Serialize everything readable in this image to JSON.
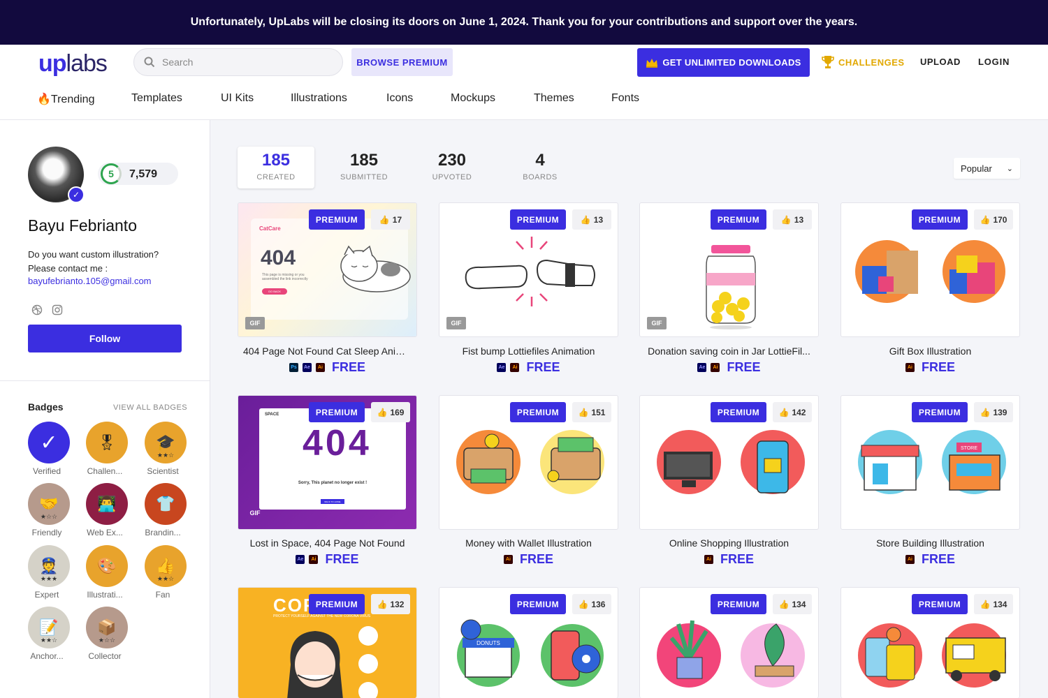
{
  "banner": {
    "text": "Unfortunately, UpLabs will be closing its doors on June 1, 2024. Thank you for your contributions and support over the years."
  },
  "header": {
    "logo_up": "up",
    "logo_labs": "labs",
    "search_placeholder": "Search",
    "browse_premium": "BROWSE PREMIUM",
    "get_unlimited": "GET UNLIMITED DOWNLOADS",
    "challenges": "CHALLENGES",
    "upload": "UPLOAD",
    "login": "LOGIN"
  },
  "nav": [
    "🔥Trending",
    "Templates",
    "UI Kits",
    "Illustrations",
    "Icons",
    "Mockups",
    "Themes",
    "Fonts"
  ],
  "profile": {
    "level": "5",
    "points": "7,579",
    "name": "Bayu Febrianto",
    "bio_line1": "Do you want custom illustration?",
    "bio_line2": "Please contact me :",
    "email": "bayufebrianto.105@gmail.com",
    "follow": "Follow"
  },
  "badges": {
    "title": "Badges",
    "view_all": "VIEW ALL BADGES",
    "items": [
      {
        "label": "Verified",
        "icon": "check-icon"
      },
      {
        "label": "Challen...",
        "icon": "challenger-icon"
      },
      {
        "label": "Scientist",
        "icon": "graduation-cap-icon"
      },
      {
        "label": "Friendly",
        "icon": "handshake-icon"
      },
      {
        "label": "Web Ex...",
        "icon": "web-expert-icon"
      },
      {
        "label": "Brandin...",
        "icon": "shirt-icon"
      },
      {
        "label": "Expert",
        "icon": "expert-icon"
      },
      {
        "label": "Illustrati...",
        "icon": "palette-icon"
      },
      {
        "label": "Fan",
        "icon": "thumbs-up-icon"
      },
      {
        "label": "Anchor...",
        "icon": "notepad-icon"
      },
      {
        "label": "Collector",
        "icon": "box-icon"
      }
    ]
  },
  "stats": [
    {
      "num": "185",
      "label": "CREATED"
    },
    {
      "num": "185",
      "label": "SUBMITTED"
    },
    {
      "num": "230",
      "label": "UPVOTED"
    },
    {
      "num": "4",
      "label": "BOARDS"
    }
  ],
  "sort": {
    "value": "Popular"
  },
  "cards": [
    {
      "title": "404 Page Not Found Cat Sleep Anim...",
      "premium": "PREMIUM",
      "votes": "17",
      "gif": "GIF",
      "apps": [
        "Ps",
        "Ae",
        "Ai"
      ],
      "price": "FREE"
    },
    {
      "title": "Fist bump Lottiefiles Animation",
      "premium": "PREMIUM",
      "votes": "13",
      "gif": "GIF",
      "apps": [
        "Ae",
        "Ai"
      ],
      "price": "FREE"
    },
    {
      "title": "Donation saving coin in Jar LottieFil...",
      "premium": "PREMIUM",
      "votes": "13",
      "gif": "GIF",
      "apps": [
        "Ae",
        "Ai"
      ],
      "price": "FREE"
    },
    {
      "title": "Gift Box Illustration",
      "premium": "PREMIUM",
      "votes": "170",
      "gif": "",
      "apps": [
        "Ai"
      ],
      "price": "FREE"
    },
    {
      "title": "Lost in Space, 404 Page Not Found",
      "premium": "PREMIUM",
      "votes": "169",
      "gif": "GIF",
      "apps": [
        "Ae",
        "Ai"
      ],
      "price": "FREE"
    },
    {
      "title": "Money with Wallet Illustration",
      "premium": "PREMIUM",
      "votes": "151",
      "gif": "",
      "apps": [
        "Ai"
      ],
      "price": "FREE"
    },
    {
      "title": "Online Shopping Illustration",
      "premium": "PREMIUM",
      "votes": "142",
      "gif": "",
      "apps": [
        "Ai"
      ],
      "price": "FREE"
    },
    {
      "title": "Store Building Illustration",
      "premium": "PREMIUM",
      "votes": "139",
      "gif": "",
      "apps": [
        "Ai"
      ],
      "price": "FREE"
    },
    {
      "title": "",
      "premium": "PREMIUM",
      "votes": "132",
      "gif": "",
      "apps": [],
      "price": ""
    },
    {
      "title": "",
      "premium": "PREMIUM",
      "votes": "136",
      "gif": "",
      "apps": [],
      "price": ""
    },
    {
      "title": "",
      "premium": "PREMIUM",
      "votes": "134",
      "gif": "",
      "apps": [],
      "price": ""
    },
    {
      "title": "",
      "premium": "PREMIUM",
      "votes": "134",
      "gif": "",
      "apps": [],
      "price": ""
    }
  ],
  "thumb_art": {
    "404_cat": {
      "brand": "CatCare",
      "code": "404",
      "text": "This page is missing or you assembled the link incorrectly",
      "button": "GO BACK"
    },
    "lost_space": {
      "brand": "SPACE",
      "code": "404",
      "text": "Sorry, This planet no longer exist !",
      "button": "BACK TO HOME"
    },
    "corona": {
      "title": "CORONA",
      "subtitle": "PROTECT YOURSELF AGAINST THE NEW CORONA VIRUS"
    },
    "store_sign": "STORE",
    "donut_sign": "DONUTS"
  },
  "colors": {
    "accent": "#3b2ee0",
    "banner_bg": "#120a3e",
    "gold": "#e2a800"
  }
}
